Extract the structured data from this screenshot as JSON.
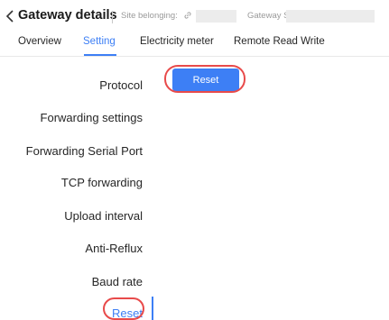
{
  "header": {
    "back_icon": "chevron-left-icon",
    "title": "Gateway details",
    "site_label": "Site belonging:",
    "site_icon": "link-icon",
    "site_value": "",
    "sn_label": "Gateway SN:",
    "sn_value": ""
  },
  "tabs": [
    {
      "label": "Overview",
      "active": false
    },
    {
      "label": "Setting",
      "active": true
    },
    {
      "label": "Electricity meter",
      "active": false
    },
    {
      "label": "Remote Read Write",
      "active": false
    }
  ],
  "side_menu": {
    "items": [
      {
        "label": "Protocol",
        "active": false
      },
      {
        "label": "Forwarding settings",
        "active": false
      },
      {
        "label": "Forwarding Serial Port",
        "active": false
      },
      {
        "label": "TCP forwarding",
        "active": false
      },
      {
        "label": "Upload interval",
        "active": false
      },
      {
        "label": "Anti-Reflux",
        "active": false
      },
      {
        "label": "Baud rate",
        "active": false
      },
      {
        "label": "Reset",
        "active": true
      }
    ]
  },
  "content": {
    "reset_button_label": "Reset"
  },
  "colors": {
    "accent": "#3d7ff5",
    "highlight": "#e84a4a",
    "placeholder": "#ececec"
  }
}
